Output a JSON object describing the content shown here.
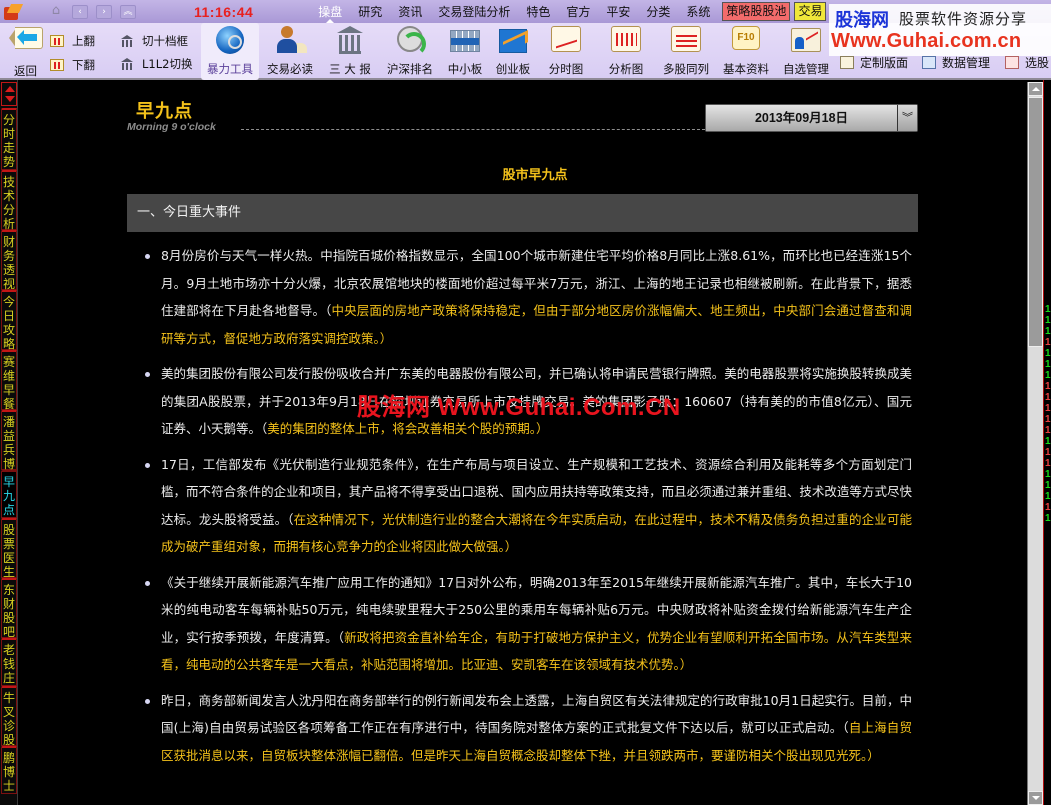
{
  "titlebar": {
    "clock": "11:16:44",
    "menus": [
      {
        "label": "操盘",
        "active": true
      },
      {
        "label": "研究"
      },
      {
        "label": "资讯"
      },
      {
        "label": "交易登陆分析"
      },
      {
        "label": "特色"
      },
      {
        "label": "官方"
      },
      {
        "label": "平安"
      },
      {
        "label": "分类"
      },
      {
        "label": "系统"
      }
    ],
    "tag_strategy": "策略股股池",
    "tag_trade": "交易"
  },
  "toolbar": {
    "back": "返回",
    "page_up": "上翻",
    "page_down": "下翻",
    "toggle_depth": "切十档框",
    "toggle_l1l2": "L1L2切换",
    "big_buttons": [
      {
        "label": "暴力工具",
        "icon": "magnifier-globe-icon",
        "selected": true
      },
      {
        "label": "交易必读",
        "icon": "person-document-icon"
      },
      {
        "label": "三 大 报",
        "icon": "temple-icon"
      },
      {
        "label": "沪深排名",
        "icon": "clock-refresh-icon"
      },
      {
        "label": "中小板",
        "icon": "grid-board-icon"
      },
      {
        "label": "创业板",
        "icon": "chart-up-icon"
      },
      {
        "label": "分时图",
        "icon": "line-chart-icon"
      },
      {
        "label": "分析图",
        "icon": "candlestick-icon"
      },
      {
        "label": "多股同列",
        "icon": "multi-wave-icon"
      },
      {
        "label": "基本资料",
        "icon": "f10-icon",
        "icon_text": "F10"
      },
      {
        "label": "自选管理",
        "icon": "portfolio-folder-icon"
      }
    ],
    "small_buttons": [
      {
        "label": "定制版面"
      },
      {
        "label": "数据管理"
      },
      {
        "label": "选股"
      }
    ]
  },
  "watermark": {
    "site": "股海网",
    "tagline": "股票软件资源分享",
    "url": "Www.Guhai.com.cn",
    "overlay": "股海网 Www.Guhai.Com.CN"
  },
  "sidebar": {
    "tabs": [
      {
        "label": "分时走势"
      },
      {
        "label": "技术分析"
      },
      {
        "label": "财务透视"
      },
      {
        "label": "今日攻略"
      },
      {
        "label": "赛维早餐"
      },
      {
        "label": "潘益兵博"
      },
      {
        "label": "早九点",
        "active": true
      },
      {
        "label": "股票医生"
      },
      {
        "label": "东财股吧"
      },
      {
        "label": "老钱庄"
      },
      {
        "label": "牛叉诊股"
      },
      {
        "label": "鹏博士"
      }
    ]
  },
  "content": {
    "brand_title": "早九点",
    "brand_subtitle": "Morning 9 o'clock",
    "date": "2013年09月18日",
    "page_heading": "股市早九点",
    "section_title": "一、今日重大事件",
    "articles": [
      {
        "text": "8月份房价与天气一样火热。中指院百城价格指数显示，全国100个城市新建住宅平均价格8月同比上涨8.61%，而环比也已经连涨15个月。9月土地市场亦十分火爆，北京农展馆地块的楼面地价超过每平米7万元，浙江、上海的地王记录也相继被刷新。在此背景下，据悉住建部将在下月赴各地督导。（",
        "note": "中央层面的房地产政策将保持稳定，但由于部分地区房价涨幅偏大、地王频出，中央部门会通过督查和调研等方式，督促地方政府落实调控政策。）"
      },
      {
        "text": "美的集团股份有限公司发行股份吸收合并广东美的电器股份有限公司，并已确认将申请民营银行牌照。美的电器股票将实施换股转换成美的集团A股股票，并于2013年9月18日在深圳证券交易所上市及挂牌交易。美的集团影子股：160607（持有美的的市值8亿元）、国元证券、小天鹅等。（",
        "note": "美的集团的整体上市，将会改善相关个股的预期。）"
      },
      {
        "text": "17日，工信部发布《光伏制造行业规范条件》，在生产布局与项目设立、生产规模和工艺技术、资源综合利用及能耗等多个方面划定门槛，而不符合条件的企业和项目，其产品将不得享受出口退税、国内应用扶持等政策支持，而且必须通过兼并重组、技术改造等方式尽快达标。龙头股将受益。（",
        "note": "在这种情况下，光伏制造行业的整合大潮将在今年实质启动，在此过程中，技术不精及债务负担过重的企业可能成为破产重组对象，而拥有核心竞争力的企业将因此做大做强。）"
      },
      {
        "text": "《关于继续开展新能源汽车推广应用工作的通知》17日对外公布，明确2013年至2015年继续开展新能源汽车推广。其中，车长大于10米的纯电动客车每辆补贴50万元，纯电续驶里程大于250公里的乘用车每辆补贴6万元。中央财政将补贴资金拨付给新能源汽车生产企业，实行按季预拨，年度清算。（",
        "note": "新政将把资金直补给车企，有助于打破地方保护主义，优势企业有望顺利开拓全国市场。从汽车类型来看，纯电动的公共客车是一大看点，补贴范围将增加。比亚迪、安凯客车在该领域有技术优势。）"
      },
      {
        "text": "昨日，商务部新闻发言人沈丹阳在商务部举行的例行新闻发布会上透露，上海自贸区有关法律规定的行政审批10月1日起实行。目前，中国(上海)自由贸易试验区各项筹备工作正在有序进行中，待国务院对整体方案的正式批复文件下达以后，就可以正式启动。（",
        "note": "自上海自贸区获批消息以来，自贸板块整体涨幅已翻倍。但是昨天上海自贸概念股却整体下挫，并且领跌两市，要谨防相关个股出现见光死。）"
      }
    ]
  },
  "quote_strip": {
    "values": [
      "1",
      "1",
      "1",
      "1",
      "1",
      "1",
      "1",
      "1",
      "1",
      "1",
      "1",
      "1",
      "1",
      "1",
      "1",
      "1",
      "1",
      "1",
      "1",
      "1"
    ],
    "colors": [
      "#18d818",
      "#18d818",
      "#18d818",
      "#e84040",
      "#18d818",
      "#18d818",
      "#18d818",
      "#e84040",
      "#e84040",
      "#e84040",
      "#e84040",
      "#e84040",
      "#18d818",
      "#e84040",
      "#e84040",
      "#18d818",
      "#18d818",
      "#18d818",
      "#e84040",
      "#18d818"
    ],
    "up_color": "#e84040",
    "down_color": "#18d818"
  }
}
